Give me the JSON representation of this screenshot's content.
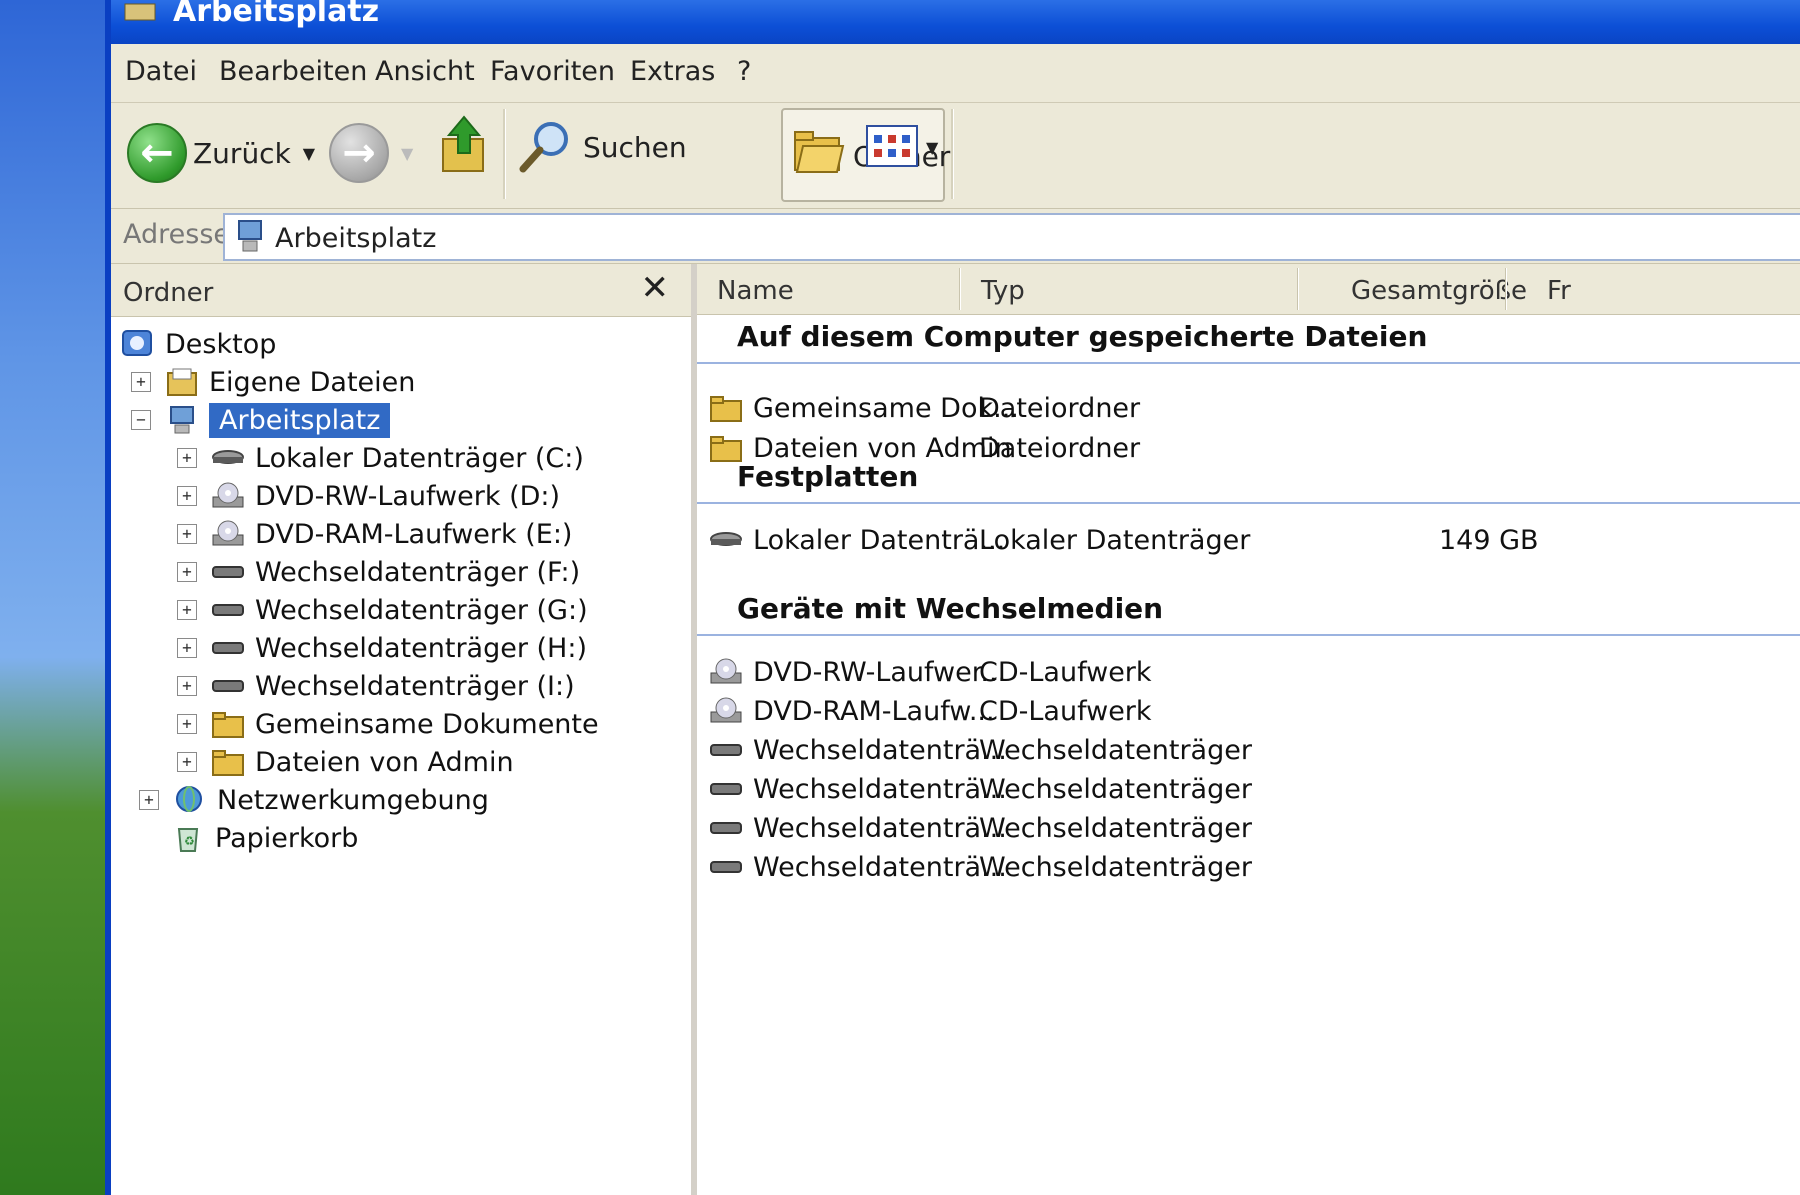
{
  "window": {
    "title": "Arbeitsplatz"
  },
  "menu": [
    "Datei",
    "Bearbeiten",
    "Ansicht",
    "Favoriten",
    "Extras",
    "?"
  ],
  "toolbar": {
    "back_label": "Zurück",
    "search_label": "Suchen",
    "folders_label": "Ordner"
  },
  "address": {
    "label": "Adresse",
    "value": "Arbeitsplatz"
  },
  "folders_pane": {
    "title": "Ordner",
    "close": "✕",
    "tree": [
      {
        "label": "Desktop",
        "icon": "desktop-icon"
      },
      {
        "label": "Eigene Dateien",
        "icon": "my-documents-icon"
      },
      {
        "label": "Arbeitsplatz",
        "icon": "my-computer-icon",
        "selected": true
      },
      {
        "label": "Lokaler Datenträger (C:)",
        "icon": "hard-drive-icon"
      },
      {
        "label": "DVD-RW-Laufwerk (D:)",
        "icon": "dvd-drive-icon"
      },
      {
        "label": "DVD-RAM-Laufwerk (E:)",
        "icon": "dvd-drive-icon"
      },
      {
        "label": "Wechseldatenträger (F:)",
        "icon": "removable-drive-icon"
      },
      {
        "label": "Wechseldatenträger (G:)",
        "icon": "removable-drive-icon"
      },
      {
        "label": "Wechseldatenträger (H:)",
        "icon": "removable-drive-icon"
      },
      {
        "label": "Wechseldatenträger (I:)",
        "icon": "removable-drive-icon"
      },
      {
        "label": "Gemeinsame Dokumente",
        "icon": "folder-icon"
      },
      {
        "label": "Dateien von Admin",
        "icon": "folder-icon"
      },
      {
        "label": "Netzwerkumgebung",
        "icon": "network-icon"
      },
      {
        "label": "Papierkorb",
        "icon": "recycle-bin-icon"
      }
    ]
  },
  "columns": {
    "name": "Name",
    "type": "Typ",
    "total_size": "Gesamtgröße",
    "free": "Fr"
  },
  "groups": {
    "stored_files": {
      "title": "Auf diesem Computer gespeicherte Dateien",
      "items": [
        {
          "name": "Gemeinsame Dok...",
          "type": "Dateiordner",
          "icon": "folder-icon"
        },
        {
          "name": "Dateien von Admin",
          "type": "Dateiordner",
          "icon": "folder-icon"
        }
      ]
    },
    "hard_disks": {
      "title": "Festplatten",
      "items": [
        {
          "name": "Lokaler Datenträ...",
          "type": "Lokaler Datenträger",
          "size": "149 GB",
          "icon": "hard-drive-icon"
        }
      ]
    },
    "removable": {
      "title": "Geräte mit Wechselmedien",
      "items": [
        {
          "name": "DVD-RW-Laufwer...",
          "type": "CD-Laufwerk",
          "icon": "dvd-drive-icon"
        },
        {
          "name": "DVD-RAM-Laufw...",
          "type": "CD-Laufwerk",
          "icon": "dvd-drive-icon"
        },
        {
          "name": "Wechseldatenträ...",
          "type": "Wechseldatenträger",
          "icon": "removable-drive-icon"
        },
        {
          "name": "Wechseldatenträ...",
          "type": "Wechseldatenträger",
          "icon": "removable-drive-icon"
        },
        {
          "name": "Wechseldatenträ...",
          "type": "Wechseldatenträger",
          "icon": "removable-drive-icon"
        },
        {
          "name": "Wechseldatenträ...",
          "type": "Wechseldatenträger",
          "icon": "removable-drive-icon"
        }
      ]
    }
  }
}
